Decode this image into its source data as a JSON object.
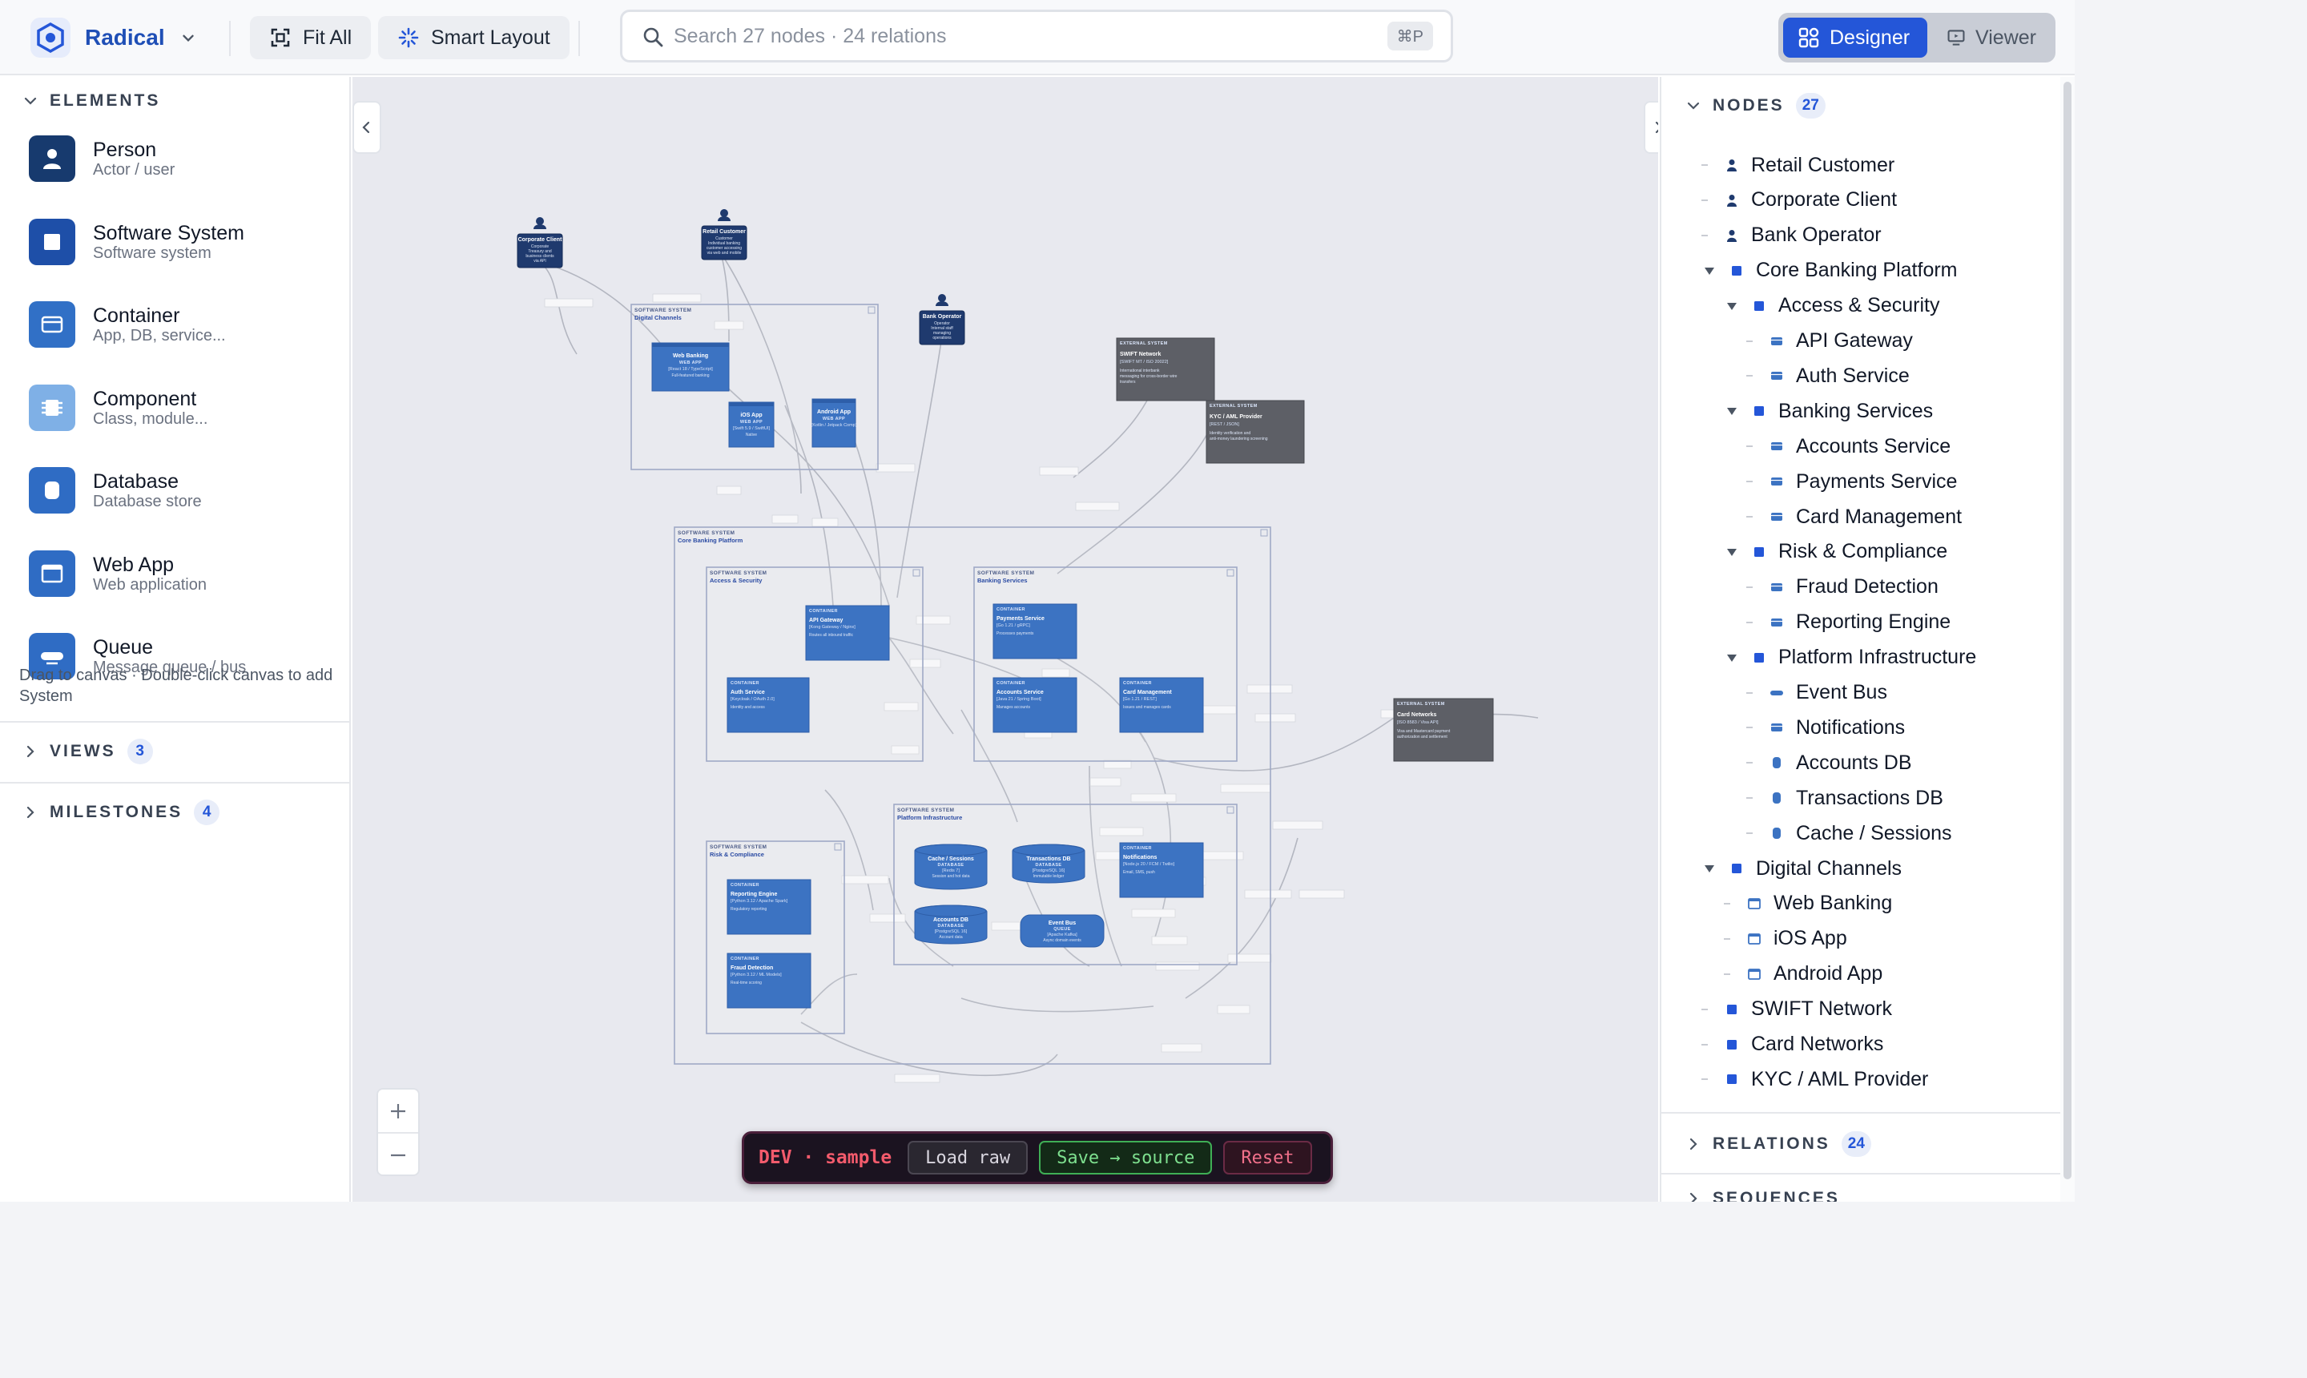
{
  "app": {
    "name": "Radical",
    "colors": {
      "accent": "#2456d8",
      "brand": "#1f4fb6",
      "container": "#3c73c2",
      "person": "#1f3a6e",
      "external": "#5d5f66"
    }
  },
  "toolbar": {
    "fit_all": "Fit All",
    "smart_layout": "Smart Layout",
    "search_placeholder": "Search 27 nodes · 24 relations",
    "search_shortcut": "⌘P",
    "mode_designer": "Designer",
    "mode_viewer": "Viewer",
    "active_mode": "Designer"
  },
  "left": {
    "elements_title": "ELEMENTS",
    "palette": [
      {
        "name": "Person",
        "sub": "Actor / user",
        "icon": "person-icon",
        "color": "#173a6e"
      },
      {
        "name": "Software System",
        "sub": "Software system",
        "icon": "software-system-icon",
        "color": "#1e4fa8"
      },
      {
        "name": "Container",
        "sub": "App, DB, service...",
        "icon": "container-icon",
        "color": "#3170c6"
      },
      {
        "name": "Component",
        "sub": "Class, module...",
        "icon": "component-icon",
        "color": "#7fb0e6"
      },
      {
        "name": "Database",
        "sub": "Database store",
        "icon": "database-icon",
        "color": "#2f6cc4"
      },
      {
        "name": "Web App",
        "sub": "Web application",
        "icon": "web-app-icon",
        "color": "#2f6cc4"
      },
      {
        "name": "Queue",
        "sub": "Message queue / bus",
        "icon": "queue-icon",
        "color": "#2f6cc4"
      }
    ],
    "hint": "Drag to canvas · Double-click canvas to add System",
    "views_title": "VIEWS",
    "views_count": "3",
    "milestones_title": "MILESTONES",
    "milestones_count": "4"
  },
  "canvas": {
    "people": [
      {
        "name": "Corporate Client",
        "lines": [
          "Corporate",
          "Treasury and",
          "business clients",
          "via API"
        ]
      },
      {
        "name": "Retail Customer",
        "lines": [
          "Customer",
          "Individual banking",
          "customer accessing",
          "via web and mobile"
        ]
      },
      {
        "name": "Bank Operator",
        "lines": [
          "Operator",
          "Internal staff",
          "managing",
          "operations"
        ]
      }
    ],
    "boundaries": [
      {
        "type": "SOFTWARE SYSTEM",
        "name": "Digital Channels"
      },
      {
        "type": "SOFTWARE SYSTEM",
        "name": "Core Banking Platform"
      },
      {
        "type": "SOFTWARE SYSTEM",
        "name": "Access & Security"
      },
      {
        "type": "SOFTWARE SYSTEM",
        "name": "Banking Services"
      },
      {
        "type": "SOFTWARE SYSTEM",
        "name": "Platform Infrastructure"
      },
      {
        "type": "SOFTWARE SYSTEM",
        "name": "Risk & Compliance"
      }
    ],
    "containers": [
      {
        "name": "Web Banking",
        "type": "WEB APP",
        "tech": "[React 18 / TypeScript]",
        "desc": "Full-featured banking"
      },
      {
        "name": "iOS App",
        "type": "WEB APP",
        "tech": "[Swift 5.9 / SwiftUI]",
        "desc": "Native"
      },
      {
        "name": "Android App",
        "type": "WEB APP",
        "tech": "[Kotlin / Jetpack Comp]",
        "desc": ""
      },
      {
        "name": "API Gateway",
        "type": "CONTAINER",
        "tech": "[Kong Gateway / Nginx]",
        "desc": "Routes all inbound traffic"
      },
      {
        "name": "Auth Service",
        "type": "CONTAINER",
        "tech": "[Keycloak / OAuth 2.0]",
        "desc": "Identity and access"
      },
      {
        "name": "Payments Service",
        "type": "CONTAINER",
        "tech": "[Go 1.21 / gRPC]",
        "desc": "Processes payments"
      },
      {
        "name": "Accounts Service",
        "type": "CONTAINER",
        "tech": "[Java 21 / Spring Boot]",
        "desc": "Manages accounts"
      },
      {
        "name": "Card Management",
        "type": "CONTAINER",
        "tech": "[Go 1.21 / REST]",
        "desc": "Issues and manages cards"
      },
      {
        "name": "Cache / Sessions",
        "type": "DATABASE",
        "tech": "[Redis 7]",
        "desc": "Session and hot data"
      },
      {
        "name": "Transactions DB",
        "type": "DATABASE",
        "tech": "[PostgreSQL 16]",
        "desc": "Immutable ledger"
      },
      {
        "name": "Notifications",
        "type": "CONTAINER",
        "tech": "[Node.js 20 / FCM / Twilio]",
        "desc": "Email, SMS, push"
      },
      {
        "name": "Accounts DB",
        "type": "DATABASE",
        "tech": "[PostgreSQL 16]",
        "desc": "Account data"
      },
      {
        "name": "Event Bus",
        "type": "QUEUE",
        "tech": "[Apache Kafka]",
        "desc": "Async domain events"
      },
      {
        "name": "Reporting Engine",
        "type": "CONTAINER",
        "tech": "[Python 3.12 / Apache Spark]",
        "desc": "Regulatory reporting"
      },
      {
        "name": "Fraud Detection",
        "type": "CONTAINER",
        "tech": "[Python 3.12 / ML Models]",
        "desc": "Real-time scoring"
      }
    ],
    "externals": [
      {
        "name": "SWIFT Network",
        "type": "EXTERNAL SYSTEM",
        "tech": "[SWIFT MT / ISO 20022]",
        "desc": "International interbank messaging for cross-border wire transfers"
      },
      {
        "name": "KYC / AML Provider",
        "type": "EXTERNAL SYSTEM",
        "tech": "[REST / JSON]",
        "desc": "Identity verification and anti-money laundering screening"
      },
      {
        "name": "Card Networks",
        "type": "EXTERNAL SYSTEM",
        "tech": "[ISO 8583 / Visa API]",
        "desc": "Visa and Mastercard payment authorization and settlement"
      }
    ],
    "zoom_in_icon": "plus-icon",
    "zoom_out_icon": "minus-icon"
  },
  "devbar": {
    "label": "DEV · sample",
    "load": "Load raw",
    "save": "Save → source",
    "reset": "Reset"
  },
  "right": {
    "nodes_title": "NODES",
    "nodes_count": "27",
    "tree": [
      {
        "label": "Retail Customer",
        "level": 0,
        "icon": "person",
        "toggle": false
      },
      {
        "label": "Corporate Client",
        "level": 0,
        "icon": "person",
        "toggle": false
      },
      {
        "label": "Bank Operator",
        "level": 0,
        "icon": "person",
        "toggle": false
      },
      {
        "label": "Core Banking Platform",
        "level": 0,
        "icon": "system",
        "toggle": true
      },
      {
        "label": "Access & Security",
        "level": 1,
        "icon": "system",
        "toggle": true
      },
      {
        "label": "API Gateway",
        "level": 2,
        "icon": "container",
        "toggle": false
      },
      {
        "label": "Auth Service",
        "level": 2,
        "icon": "container",
        "toggle": false
      },
      {
        "label": "Banking Services",
        "level": 1,
        "icon": "system",
        "toggle": true
      },
      {
        "label": "Accounts Service",
        "level": 2,
        "icon": "container",
        "toggle": false
      },
      {
        "label": "Payments Service",
        "level": 2,
        "icon": "container",
        "toggle": false
      },
      {
        "label": "Card Management",
        "level": 2,
        "icon": "container",
        "toggle": false
      },
      {
        "label": "Risk & Compliance",
        "level": 1,
        "icon": "system",
        "toggle": true
      },
      {
        "label": "Fraud Detection",
        "level": 2,
        "icon": "container",
        "toggle": false
      },
      {
        "label": "Reporting Engine",
        "level": 2,
        "icon": "container",
        "toggle": false
      },
      {
        "label": "Platform Infrastructure",
        "level": 1,
        "icon": "system",
        "toggle": true
      },
      {
        "label": "Event Bus",
        "level": 2,
        "icon": "queue",
        "toggle": false
      },
      {
        "label": "Notifications",
        "level": 2,
        "icon": "container",
        "toggle": false
      },
      {
        "label": "Accounts DB",
        "level": 2,
        "icon": "database",
        "toggle": false
      },
      {
        "label": "Transactions DB",
        "level": 2,
        "icon": "database",
        "toggle": false
      },
      {
        "label": "Cache / Sessions",
        "level": 2,
        "icon": "database",
        "toggle": false
      },
      {
        "label": "Digital Channels",
        "level": 0,
        "icon": "system",
        "toggle": true
      },
      {
        "label": "Web Banking",
        "level": 1,
        "icon": "webapp",
        "toggle": false
      },
      {
        "label": "iOS App",
        "level": 1,
        "icon": "webapp",
        "toggle": false
      },
      {
        "label": "Android App",
        "level": 1,
        "icon": "webapp",
        "toggle": false
      },
      {
        "label": "SWIFT Network",
        "level": 0,
        "icon": "system",
        "toggle": false
      },
      {
        "label": "Card Networks",
        "level": 0,
        "icon": "system",
        "toggle": false
      },
      {
        "label": "KYC / AML Provider",
        "level": 0,
        "icon": "system",
        "toggle": false
      }
    ],
    "relations_title": "RELATIONS",
    "relations_count": "24",
    "sequences_title": "SEQUENCES"
  }
}
